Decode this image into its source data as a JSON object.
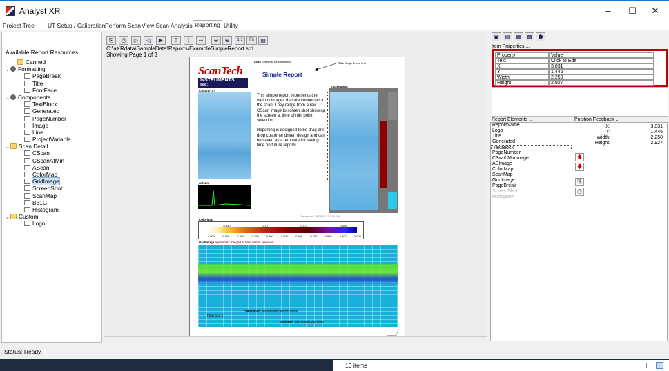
{
  "window": {
    "title": "Analyst XR",
    "min": "–",
    "max": "☐",
    "close": "✕"
  },
  "menu": [
    "Project Tree",
    "UT Setup / Calibration",
    "Perform Scan",
    "View Scan",
    "Analysis",
    "Reporting",
    "Utility"
  ],
  "left": {
    "title": "Available Report Resources ...",
    "tree": [
      {
        "label": "Canned",
        "level": 1,
        "icon": "folder",
        "toggle": ""
      },
      {
        "label": "Formatting",
        "level": 0,
        "icon": "gear",
        "toggle": "⌄"
      },
      {
        "label": "PageBreak",
        "level": 2,
        "icon": "doc",
        "toggle": ""
      },
      {
        "label": "Title",
        "level": 2,
        "icon": "doc",
        "toggle": ""
      },
      {
        "label": "FontFace",
        "level": 2,
        "icon": "doc",
        "toggle": ""
      },
      {
        "label": "Components",
        "level": 0,
        "icon": "gear",
        "toggle": "⌄"
      },
      {
        "label": "TextBlock",
        "level": 2,
        "icon": "doc",
        "toggle": ""
      },
      {
        "label": "Generated",
        "level": 2,
        "icon": "doc",
        "toggle": ""
      },
      {
        "label": "PageNumber",
        "level": 2,
        "icon": "doc",
        "toggle": ""
      },
      {
        "label": "Image",
        "level": 2,
        "icon": "doc",
        "toggle": ""
      },
      {
        "label": "Line",
        "level": 2,
        "icon": "doc",
        "toggle": ""
      },
      {
        "label": "ProjectVariable",
        "level": 2,
        "icon": "doc",
        "toggle": ""
      },
      {
        "label": "Scan Detail",
        "level": 0,
        "icon": "folder",
        "toggle": "⌄"
      },
      {
        "label": "CScan",
        "level": 2,
        "icon": "doc",
        "toggle": ""
      },
      {
        "label": "CScanAtMin",
        "level": 2,
        "icon": "doc",
        "toggle": ""
      },
      {
        "label": "AScan",
        "level": 2,
        "icon": "doc",
        "toggle": ""
      },
      {
        "label": "ColorMap",
        "level": 2,
        "icon": "doc",
        "toggle": ""
      },
      {
        "label": "GridImage",
        "level": 2,
        "icon": "doc",
        "toggle": "",
        "selected": true
      },
      {
        "label": "ScreenShot",
        "level": 2,
        "icon": "doc",
        "toggle": ""
      },
      {
        "label": "ScanMap",
        "level": 2,
        "icon": "doc",
        "toggle": ""
      },
      {
        "label": "B31G",
        "level": 2,
        "icon": "doc",
        "toggle": ""
      },
      {
        "label": "Histogram",
        "level": 2,
        "icon": "doc",
        "toggle": ""
      },
      {
        "label": "Custom",
        "level": 0,
        "icon": "folder",
        "toggle": "⌄"
      },
      {
        "label": "Logo",
        "level": 2,
        "icon": "doc",
        "toggle": ""
      }
    ]
  },
  "center": {
    "toolbar": [
      "⎘",
      "⎙",
      "▷",
      "◁",
      "▶",
      "⇡",
      "⇣",
      "⇢",
      "⊖",
      "⊕",
      "1:1",
      "Fit",
      "▤"
    ],
    "path": "C:\\aXRdata\\SampleData\\Reports\\ExampleSimpleReport.srd",
    "pageinfo": "Showing Page 1 of 3",
    "report": {
      "logo_line1": "ScanTech",
      "logo_line2": "INSTRUMENTS, INC.",
      "logo_note": "Logo",
      "logo_note2": "Users will be substituted",
      "title": "Simple Report",
      "title_note": "Title",
      "title_note2": "Single line of text",
      "cscan": "CScan",
      "cscan_unit": "(cm)",
      "cscanatmin": "CScanAtMin",
      "ascan": "AScan",
      "textblock": "This simple report represents the various images that are connected to the scan. They range from a raw CScan image to screen shot showing the screen at time of min point selection.\n\nReporting is designed to be drag and drop customer driven design and can be saved as a template for saving time on future reports.",
      "generated_small": "Generated 1/4/2018 2:30:45 PM",
      "colormap": "ColorMap",
      "cm_top": [
        "0.550",
        "0.07",
        "0.073",
        "0.346"
      ],
      "cm_ticks": [
        "0.000",
        "0.100",
        "0.200",
        "0.300",
        "0.400",
        "0.500",
        "0.600",
        "0.700",
        "0.800",
        "0.900",
        "1.000"
      ],
      "grid_label": "GridImage",
      "grid_note": "represents the grid at time of min selection",
      "pagenumber_label": "PageNumber",
      "pagenumber_note": "Automatically numbers pages",
      "page_of": "Page 1 of 3",
      "generated_label": "Generated",
      "generated_note": "Time Stamps your report."
    }
  },
  "right": {
    "toolbar": [
      "▣",
      "▤",
      "▦",
      "▩",
      "⬢"
    ],
    "props_title": "Item Properties ...",
    "props": [
      [
        "Property",
        "Value"
      ],
      [
        "Text",
        "Click to Edit"
      ],
      [
        "X",
        "3.031"
      ],
      [
        "Y",
        "1.446"
      ],
      [
        "Width",
        "2.250"
      ],
      [
        "Height",
        "2.927"
      ]
    ],
    "elements_title": "Report Elements ...",
    "elements": [
      "ReportName",
      "Logo",
      "Title",
      "Generated",
      "TextBlock",
      "PageNumber",
      "CSwithMinImage",
      "ASImage",
      "ColorMap",
      "ScanMap",
      "GridImage",
      "PageBreak",
      "ScreenShot",
      "Histogram"
    ],
    "feedback_title": "Poistion Feedback ...",
    "feedback": [
      [
        "X:",
        "3.031"
      ],
      [
        "Y:",
        "1.446"
      ],
      [
        "Width:",
        "2.250"
      ],
      [
        "Height:",
        "2.927"
      ]
    ],
    "arrow_up": "🡅",
    "arrow_down": "🡇"
  },
  "status": "Status: Ready.",
  "taskbar": {
    "items": "10 items"
  },
  "colors": {
    "accent": "#1a73c8",
    "highlight": "#c00000",
    "grid": "#18b0d8"
  }
}
